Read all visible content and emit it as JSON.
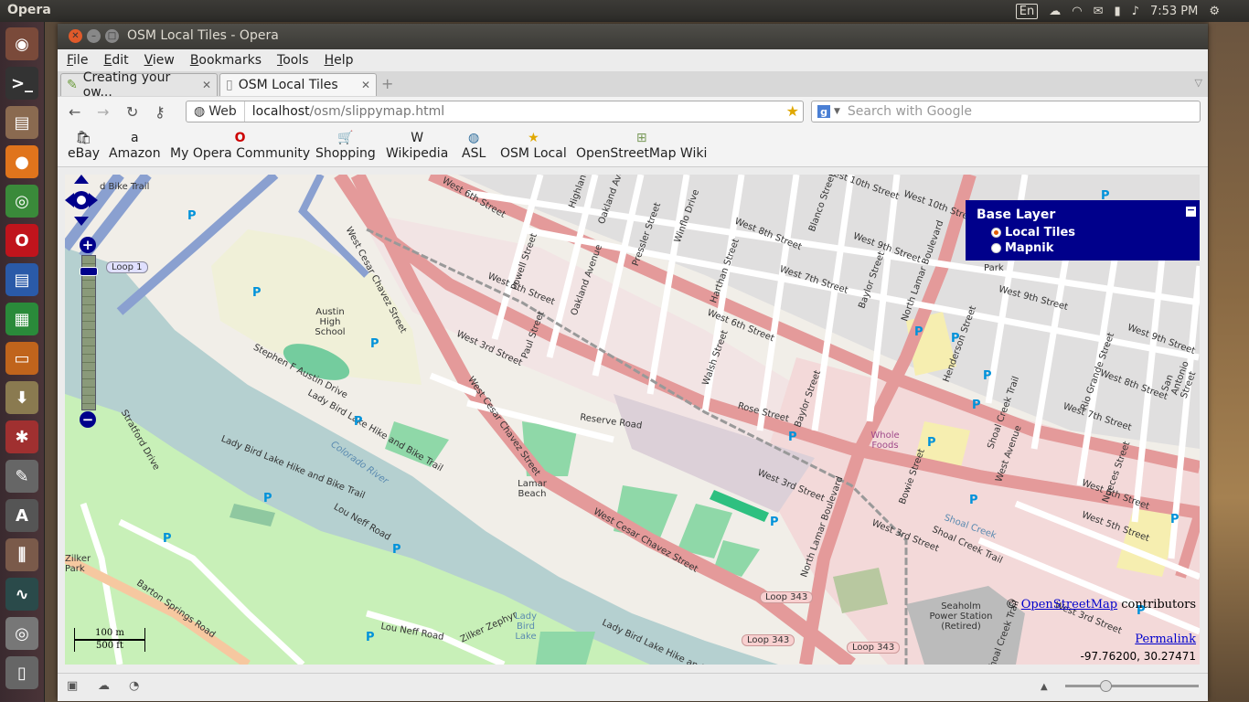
{
  "top_panel": {
    "app_name": "Opera",
    "keyboard": "En",
    "clock": "7:53 PM"
  },
  "launcher": {
    "items": [
      "dash-icon",
      "terminal-icon",
      "files-icon",
      "firefox-icon",
      "chrome-icon",
      "opera-icon",
      "writer-icon",
      "calc-icon",
      "impress-icon",
      "archive-icon",
      "settings-icon",
      "text-editor-icon",
      "software-center-icon",
      "mixer-icon",
      "system-monitor-icon",
      "disc-icon",
      "trash-icon"
    ]
  },
  "window": {
    "title": "OSM Local Tiles - Opera",
    "menu": [
      "File",
      "Edit",
      "View",
      "Bookmarks",
      "Tools",
      "Help"
    ],
    "tabs": [
      {
        "label": "Creating your ow...",
        "active": false
      },
      {
        "label": "OSM Local Tiles",
        "active": true
      }
    ],
    "address": {
      "badge": "Web",
      "host": "localhost",
      "path": "/osm/slippymap.html"
    },
    "search_placeholder": "Search with Google",
    "bookmarks": [
      "eBay",
      "Amazon",
      "My Opera Community",
      "Shopping",
      "Wikipedia",
      "ASL",
      "OSM Local",
      "OpenStreetMap Wiki"
    ]
  },
  "map": {
    "layer_switcher": {
      "title": "Base Layer",
      "options": [
        {
          "label": "Local Tiles",
          "selected": true
        },
        {
          "label": "Mapnik",
          "selected": false
        }
      ]
    },
    "attribution_prefix": "©",
    "attribution_link": "OpenStreetMap",
    "attribution_suffix": "contributors",
    "permalink": "Permalink",
    "coordinates": "-97.76200, 30.27471",
    "scale_m": "100 m",
    "scale_ft": "500 ft",
    "labels": {
      "loop1": "Loop 1",
      "loop343a": "Loop 343",
      "loop343b": "Loop 343",
      "loop343c": "Loop 343",
      "w6th_a": "West 6th Street",
      "w6th_b": "West 6th Street",
      "w6th_c": "West 6th Street",
      "w5th_a": "West 5th Street",
      "w5th_b": "West 5th Street",
      "wcesar_a": "West Cesar Chavez Street",
      "wcesar_b": "West Cesar Chavez Street",
      "wcesar_c": "West Cesar Chavez Street",
      "lamar_a": "North Lamar Boulevard",
      "lamar_b": "North Lamar Boulevard",
      "w3rd_a": "West 3rd Street",
      "w3rd_b": "West 3rd Street",
      "w3rd_c": "West 3rd Street",
      "w3rd_d": "West 3rd Street",
      "w4th": "West 4th Street",
      "w7th_a": "West 7th Street",
      "w7th_b": "West 7th Street",
      "w8th_a": "West 8th Street",
      "w8th_b": "West 8th Street",
      "w9th_a": "West 9th Street",
      "w9th_b": "West 9th Street",
      "w9th_c": "West 9th Street",
      "w10th_a": "West 10th Street",
      "w10th_b": "West 10th Street",
      "austin_hs": "Austin High School",
      "stephenf": "Stephen F Austin Drive",
      "ladybird_trail_a": "Lady Bird Lake Hike and Bike Trail",
      "ladybird_trail_b": "Lady Bird Lake Hike and Bike Trail",
      "ladybird_trail_c": "Lady Bird Lake Hike and Bike Trail",
      "colorado": "Colorado River",
      "stratford": "Stratford Drive",
      "zilker": "Zilker Park",
      "barton": "Barton Springs Road",
      "lou_neff_a": "Lou Neff Road",
      "lou_neff_b": "Lou Neff Road",
      "zilker_zephyr": "Zilker Zephyr",
      "ladybird_lake": "Lady Bird Lake",
      "lamar_beach": "Lamar Beach",
      "reserve": "Reserve Road",
      "rose": "Rose Street",
      "baylor_a": "Baylor Street",
      "baylor_b": "Baylor Street",
      "blanco": "Blanco Street",
      "harthan": "Harthan Street",
      "walsh": "Walsh Street",
      "winflo": "Winflo Drive",
      "pressler": "Pressler Street",
      "oakland_a": "Oakland Avenue",
      "oakland_b": "Oakland Avenue",
      "powell": "Powell Street",
      "paul": "Paul Street",
      "highland": "Highland",
      "henderson": "Henderson Street",
      "bowie": "Bowie Street",
      "shoal_a": "Shoal Creek Trail",
      "shoal_b": "Shoal Creek Trail",
      "shoal_creek": "Shoal Creek",
      "shoal_blvd": "Shoal Creek Trail",
      "nueces": "Nueces Street",
      "rio_grande": "Rio Grande Street",
      "san_antonio": "San Antonio Street",
      "west_ave": "West Avenue",
      "whole_foods": "Whole Foods",
      "seaholm": "Seaholm Power Station (Retired)",
      "park": "Park",
      "bike_trail": "d Bike Trail"
    }
  }
}
